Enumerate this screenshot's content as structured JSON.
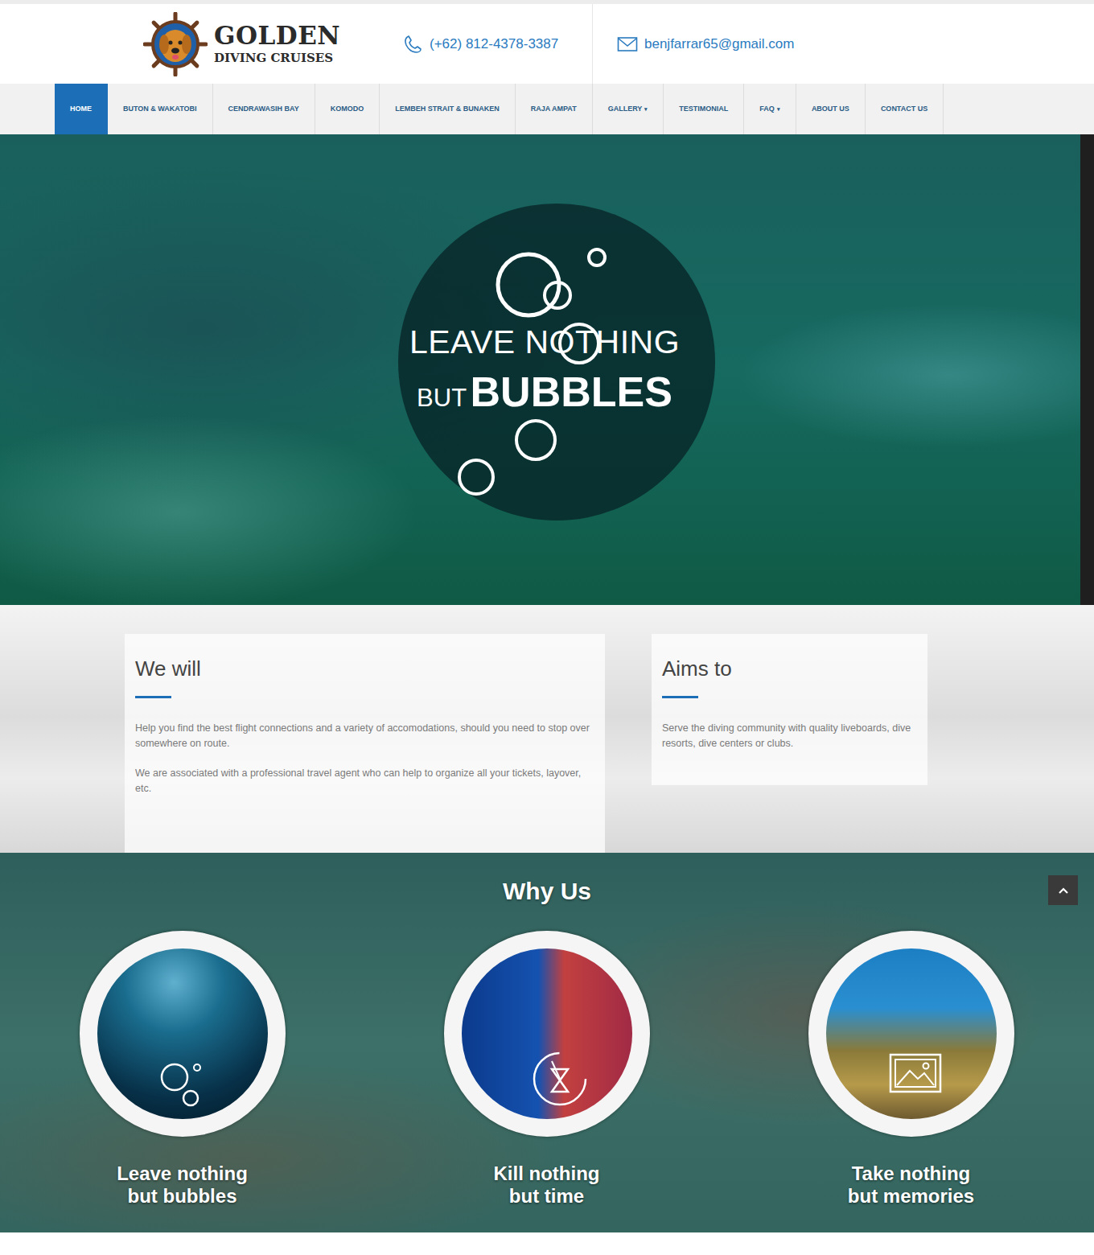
{
  "header": {
    "logo_title": "GOLDEN",
    "logo_subtitle": "DIVING CRUISES",
    "phone": "(+62) 812-4378-3387",
    "email": "benjfarrar65@gmail.com"
  },
  "nav": [
    {
      "label": "HOME",
      "selected": true
    },
    {
      "label": "BUTON & WAKATOBI",
      "selected": false
    },
    {
      "label": "CENDRAWASIH BAY",
      "selected": false
    },
    {
      "label": "KOMODO",
      "selected": false
    },
    {
      "label": "LEMBEH STRAIT & BUNAKEN",
      "selected": false
    },
    {
      "label": "RAJA AMPAT",
      "selected": false
    },
    {
      "label": "GALLERY",
      "caret": "▾",
      "selected": false
    },
    {
      "label": "TESTIMONIAL",
      "selected": false
    },
    {
      "label": "FAQ",
      "caret": "▾",
      "selected": false
    },
    {
      "label": "ABOUT US",
      "selected": false
    },
    {
      "label": "CONTACT US",
      "selected": false
    }
  ],
  "hero": {
    "line1": "LEAVE NOTHING",
    "line2a": "BUT",
    "line2b": "BUBBLES"
  },
  "intro": [
    {
      "title": "We will",
      "paragraphs": [
        "Help you find the best flight connections and a variety of accomodations, should you need to stop over somewhere on route.",
        "We are associated with a professional travel agent who can help to organize all your tickets, layover, etc."
      ]
    },
    {
      "title": "Aims to",
      "paragraphs": [
        "Serve the diving community with quality liveboards, dive resorts, dive centers or clubs."
      ]
    }
  ],
  "why_us": {
    "title": "Why Us",
    "items": [
      {
        "kind": "bubbles",
        "lines": [
          "Leave nothing",
          "but bubbles"
        ]
      },
      {
        "kind": "time",
        "lines": [
          "Kill nothing",
          "but time"
        ]
      },
      {
        "kind": "memories",
        "lines": [
          "Take nothing",
          "but memories"
        ]
      }
    ]
  }
}
